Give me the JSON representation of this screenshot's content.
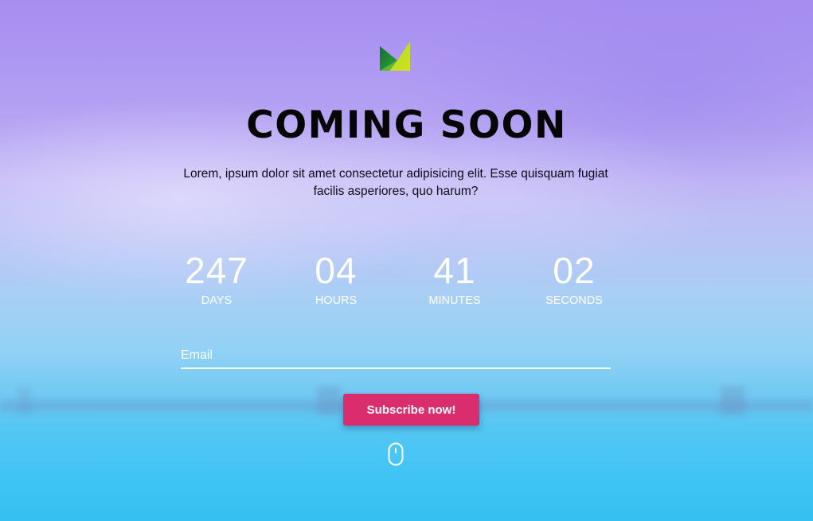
{
  "page": {
    "title": "COMING SOON",
    "description": "Lorem, ipsum dolor sit amet consectetur adipisicing elit. Esse quisquam fugiat facilis asperiores, quo harum?"
  },
  "logo": {
    "icon": "m-logo-icon",
    "colors": [
      "#1f9c3a",
      "#8bd12a",
      "#c8e021"
    ]
  },
  "countdown": [
    {
      "value": "247",
      "label": "DAYS"
    },
    {
      "value": "04",
      "label": "HOURS"
    },
    {
      "value": "41",
      "label": "MINUTES"
    },
    {
      "value": "02",
      "label": "SECONDS"
    }
  ],
  "form": {
    "email_placeholder": "Email",
    "email_value": "",
    "subscribe_label": "Subscribe now!"
  },
  "scroll_indicator": {
    "icon": "mouse-scroll-icon"
  },
  "colors": {
    "accent": "#d92d6e",
    "text_dark": "#060606",
    "text_light": "#ffffff"
  }
}
